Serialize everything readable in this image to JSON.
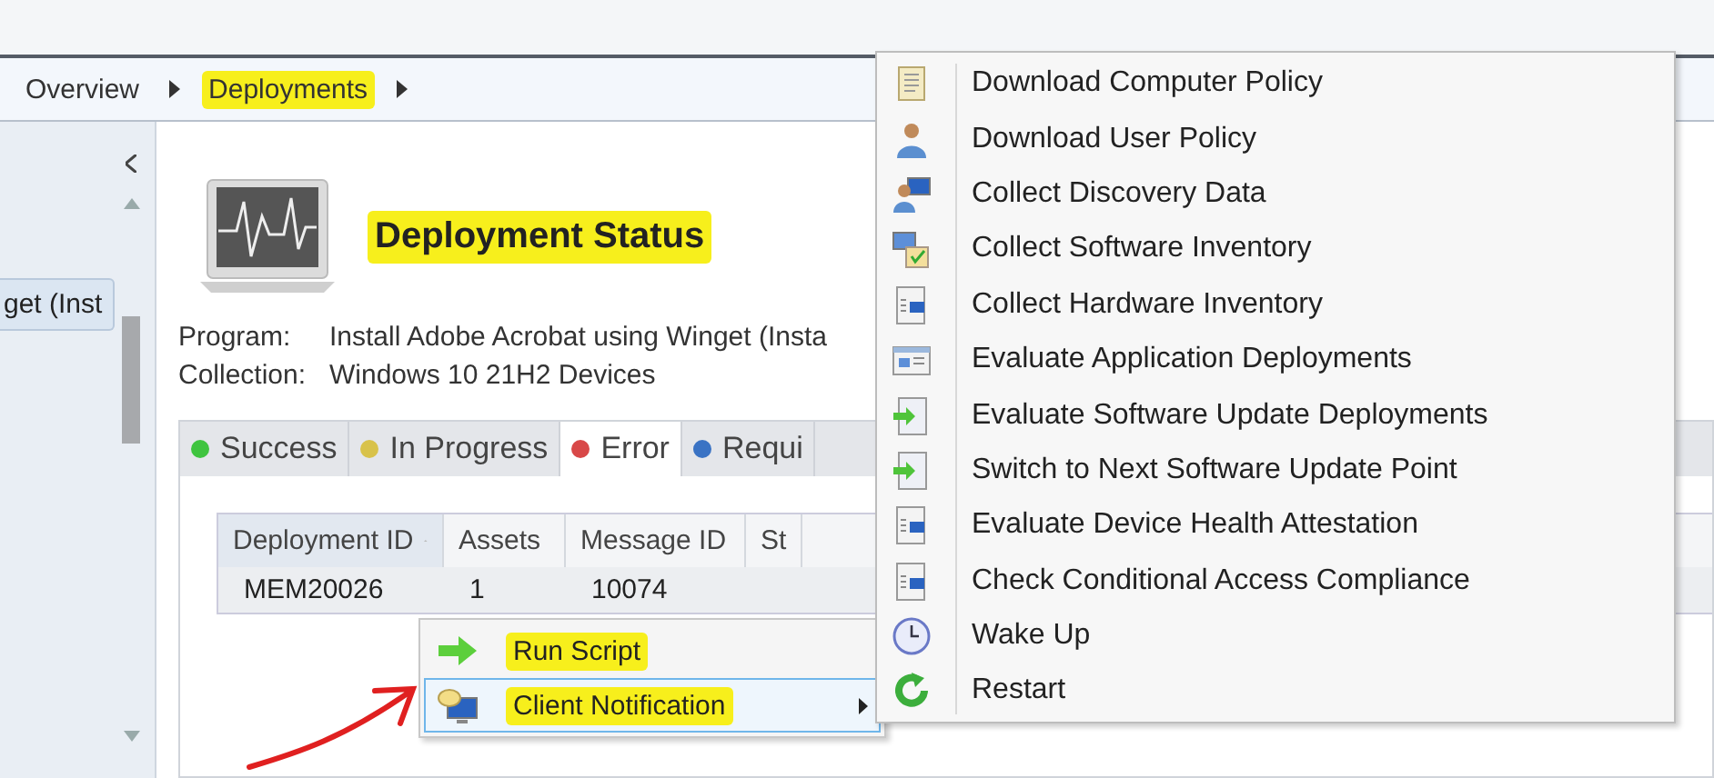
{
  "breadcrumb": [
    {
      "label": "Overview",
      "highlighted": false
    },
    {
      "label": "Deployments",
      "highlighted": true
    }
  ],
  "sidebar": {
    "items": [
      {
        "label": "get (Inst",
        "selected": true
      }
    ]
  },
  "header": {
    "title": "Deployment Status",
    "title_highlighted": true
  },
  "details": [
    {
      "label": "Program:",
      "value": "Install Adobe Acrobat using Winget (Insta"
    },
    {
      "label": "Collection:",
      "value": "Windows 10 21H2 Devices"
    }
  ],
  "tabs": [
    {
      "label": "Success",
      "color": "#3fc43f",
      "selected": false
    },
    {
      "label": "In Progress",
      "color": "#d8c24a",
      "selected": false
    },
    {
      "label": "Error",
      "color": "#d84848",
      "selected": true
    },
    {
      "label": "Requi",
      "color": "#3a73c4",
      "selected": false
    }
  ],
  "table": {
    "columns": [
      {
        "label": "Deployment ID",
        "sorted": true
      },
      {
        "label": "Assets",
        "sorted": false
      },
      {
        "label": "Message ID",
        "sorted": false
      },
      {
        "label": "St",
        "sorted": false
      }
    ],
    "rows": [
      [
        "MEM20026",
        "1",
        "10074"
      ]
    ]
  },
  "context_menu": {
    "items": [
      {
        "label": "Run Script",
        "highlighted": true,
        "selected": false,
        "submenu": false
      },
      {
        "label": "Client Notification",
        "highlighted": true,
        "selected": true,
        "submenu": true
      }
    ]
  },
  "submenu": {
    "items": [
      {
        "label": "Download Computer Policy"
      },
      {
        "label": "Download User Policy"
      },
      {
        "label": "Collect Discovery Data"
      },
      {
        "label": "Collect Software Inventory"
      },
      {
        "label": "Collect Hardware Inventory"
      },
      {
        "label": "Evaluate Application Deployments"
      },
      {
        "label": "Evaluate Software Update Deployments"
      },
      {
        "label": "Switch to Next Software Update Point"
      },
      {
        "label": "Evaluate Device Health Attestation"
      },
      {
        "label": "Check Conditional Access Compliance"
      },
      {
        "label": "Wake Up"
      },
      {
        "label": "Restart"
      }
    ]
  }
}
